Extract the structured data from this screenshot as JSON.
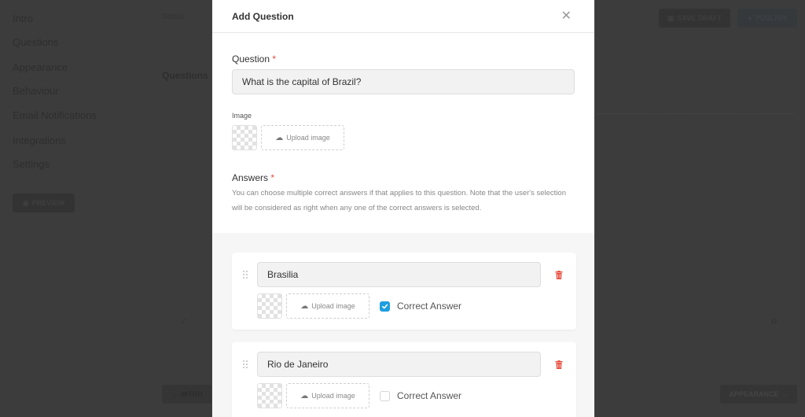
{
  "background": {
    "sidebar": {
      "items": [
        {
          "label": "Intro"
        },
        {
          "label": "Questions"
        },
        {
          "label": "Appearance"
        },
        {
          "label": "Behaviour"
        },
        {
          "label": "Email Notifications"
        },
        {
          "label": "Integrations"
        },
        {
          "label": "Settings"
        }
      ],
      "preview_label": "PREVIEW"
    },
    "status_label": "Status",
    "section_title": "Questions",
    "save_draft_label": "SAVE DRAFT",
    "publish_label": "PUBLISH",
    "prev_label": "INTRO",
    "next_label": "APPEARANCE"
  },
  "modal": {
    "title": "Add Question",
    "question": {
      "label": "Question",
      "required_mark": "*",
      "value": "What is the capital of Brazil?"
    },
    "image": {
      "label": "Image",
      "upload_label": "Upload image"
    },
    "answers": {
      "label": "Answers",
      "required_mark": "*",
      "help": "You can choose multiple correct answers if that applies to this question. Note that the user's selection will be considered as right when any one of the correct answers is selected.",
      "items": [
        {
          "value": "Brasilia",
          "upload_label": "Upload image",
          "correct_label": "Correct Answer",
          "correct": true
        },
        {
          "value": "Rio de Janeiro",
          "upload_label": "Upload image",
          "correct_label": "Correct Answer",
          "correct": false
        }
      ]
    }
  },
  "colors": {
    "accent": "#1e9ee0",
    "danger": "#e74c3c",
    "overlay": "#3c3c3c"
  }
}
